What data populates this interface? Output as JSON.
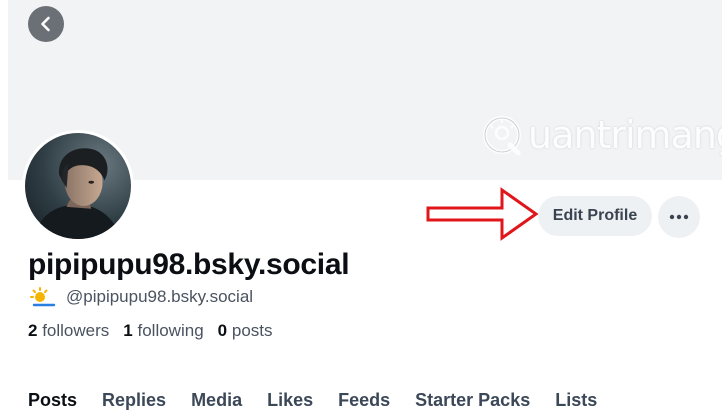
{
  "header": {
    "back_icon": "chevron-left-icon",
    "watermark_text": "uantrimang"
  },
  "profile": {
    "display_name": "pipipupu98.bsky.social",
    "handle": "@pipipupu98.bsky.social",
    "handle_icon": "sun-cloud-icon",
    "followers_count": "2",
    "followers_label": "followers",
    "following_count": "1",
    "following_label": "following",
    "posts_count": "0",
    "posts_label": "posts"
  },
  "actions": {
    "edit_profile_label": "Edit Profile",
    "more_icon": "ellipsis-icon"
  },
  "tabs": [
    {
      "label": "Posts",
      "active": true
    },
    {
      "label": "Replies"
    },
    {
      "label": "Media"
    },
    {
      "label": "Likes"
    },
    {
      "label": "Feeds"
    },
    {
      "label": "Starter Packs"
    },
    {
      "label": "Lists"
    }
  ],
  "colors": {
    "banner": "#f1f3f5",
    "button_bg": "#eef1f4",
    "annotation_arrow": "#e0161b",
    "text_primary": "#0b0f14",
    "text_secondary": "#4a5360"
  }
}
